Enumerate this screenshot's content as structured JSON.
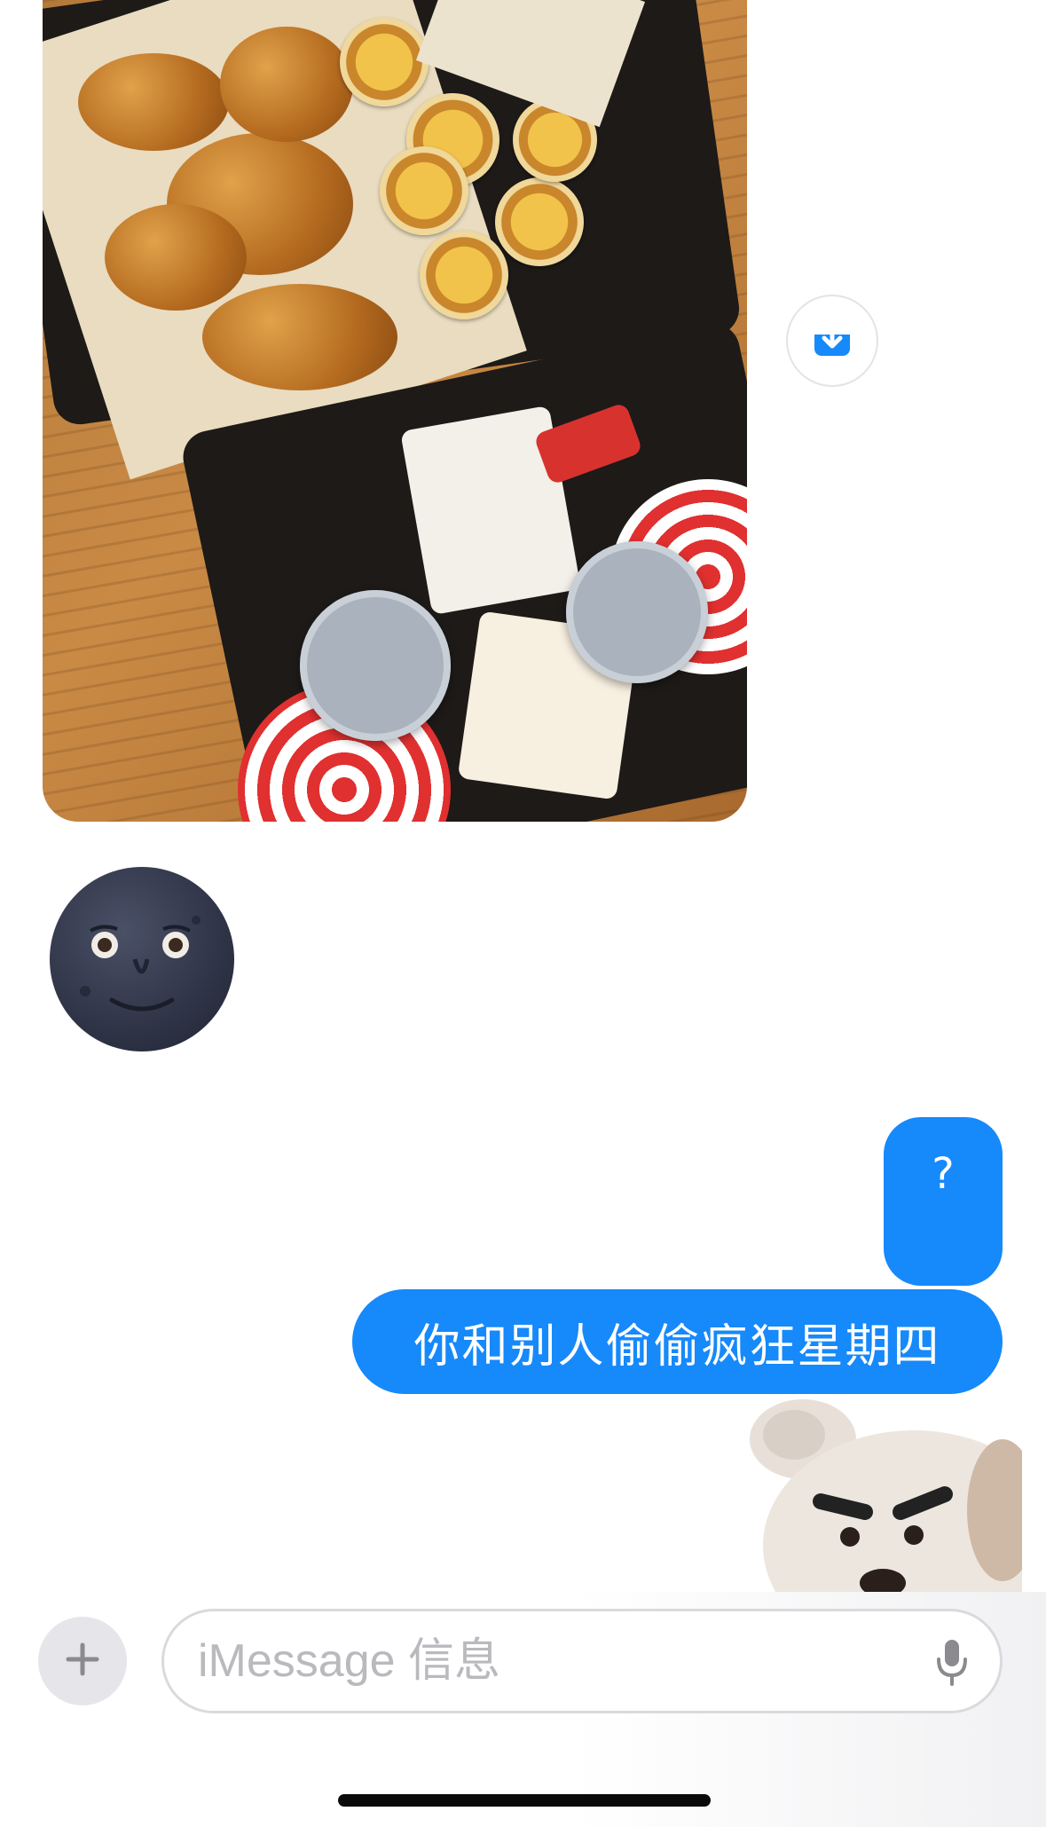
{
  "conversation": {
    "photo": {
      "description_icon": "food-photo-icon"
    },
    "download_icon": "download-icon",
    "received_emoji": "new-moon-face-emoji",
    "sent_messages": [
      {
        "text": "?"
      },
      {
        "text": "你和别人偷偷疯狂星期四"
      }
    ],
    "sticker_icon": "dog-sticker-icon"
  },
  "composer": {
    "placeholder": "iMessage 信息",
    "plus_icon": "plus-icon",
    "mic_icon": "microphone-icon"
  },
  "colors": {
    "bubble_blue": "#1689fb",
    "moon_dark": "#2f3447",
    "download_blue": "#1689fb"
  }
}
